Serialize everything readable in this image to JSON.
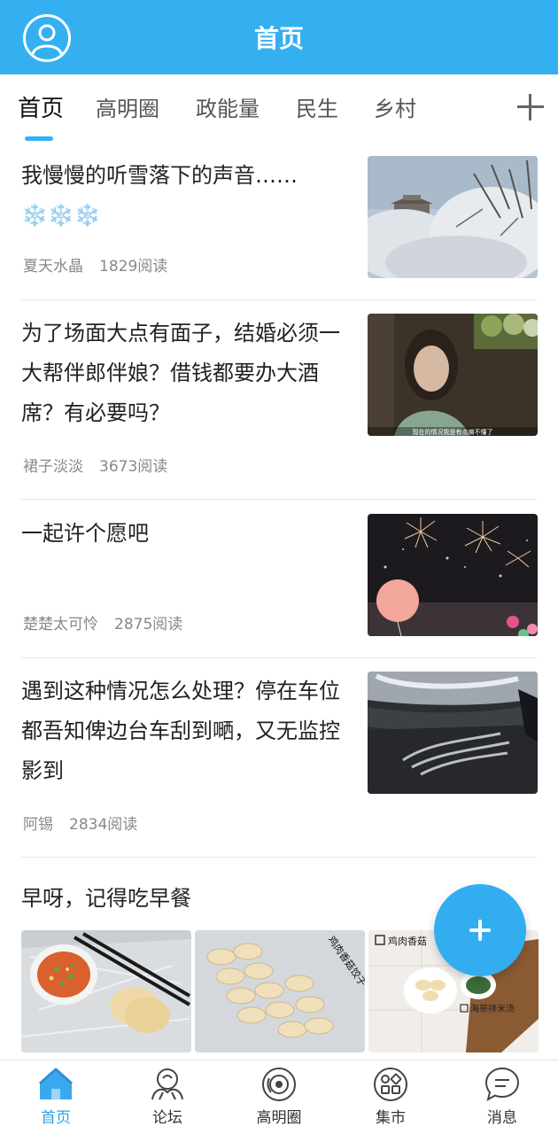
{
  "header": {
    "title": "首页",
    "avatar_icon": "user-circle-icon"
  },
  "tabs": [
    {
      "label": "首页",
      "active": true
    },
    {
      "label": "高明圈",
      "active": false
    },
    {
      "label": "政能量",
      "active": false
    },
    {
      "label": "民生",
      "active": false
    },
    {
      "label": "乡村",
      "active": false
    }
  ],
  "tab_add_icon": "plus-icon",
  "posts": [
    {
      "title": "我慢慢的听雪落下的声音……",
      "emoji": "❄️❄️❄️",
      "author": "夏天水晶",
      "reads": "1829阅读",
      "image": "frosty-trees-with-temple"
    },
    {
      "title": "为了场面大点有面子，结婚必须一大帮伴郎伴娘？借钱都要办大酒席？有必要吗？",
      "author": "裙子淡淡",
      "reads": "3673阅读",
      "image": "drama-still-girl-in-market",
      "caption": "现在的情况我是有点搞不懂了"
    },
    {
      "title": "一起许个愿吧",
      "author": "楚楚太可怜",
      "reads": "2875阅读",
      "image": "fireworks-and-balloons"
    },
    {
      "title": "遇到这种情况怎么处理？停在车位都吾知俾边台车刮到嗮，又无监控影到",
      "author": "阿锡",
      "reads": "2834阅读",
      "image": "scratched-car-bumper"
    }
  ],
  "multi_post": {
    "title": "早呀，记得吃早餐",
    "images": [
      {
        "image": "dumpling-filling-bowl"
      },
      {
        "image": "wrapped-dumplings",
        "caption": "鸡肉香菇饺子"
      },
      {
        "image": "dumplings-and-soup",
        "caption_top": "鸡肉香菇",
        "caption_bottom": "海带排米汤"
      }
    ]
  },
  "fab": {
    "icon": "plus-icon"
  },
  "bottom_nav": [
    {
      "label": "首页",
      "icon": "home-icon",
      "active": true
    },
    {
      "label": "论坛",
      "icon": "forum-icon",
      "active": false
    },
    {
      "label": "高明圈",
      "icon": "circle-icon",
      "active": false
    },
    {
      "label": "集市",
      "icon": "market-icon",
      "active": false
    },
    {
      "label": "消息",
      "icon": "message-icon",
      "active": false
    }
  ],
  "colors": {
    "brand": "#34b0f0",
    "active_nav": "#2e9fe6",
    "meta_text": "#888888"
  }
}
